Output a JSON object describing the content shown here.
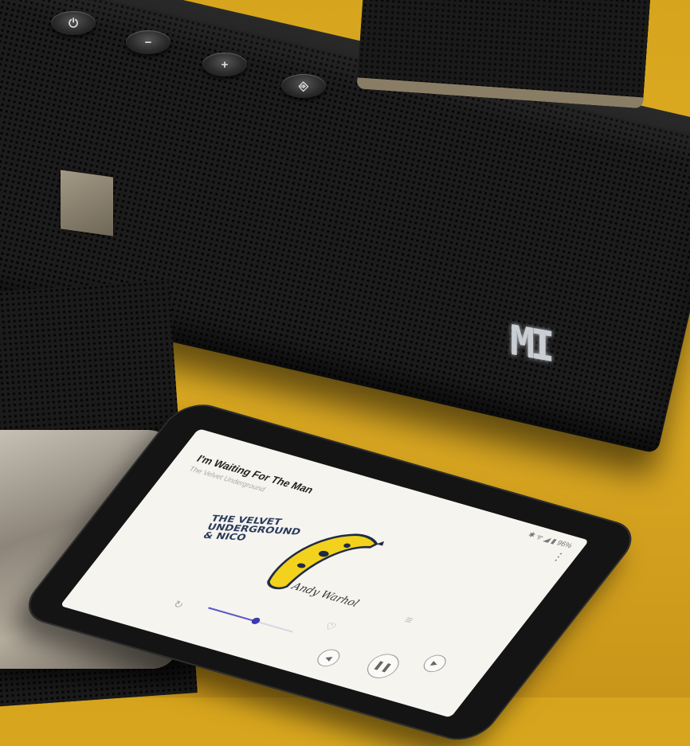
{
  "photo": {
    "background_color": "#dca923",
    "subject": ""
  },
  "soundbar": {
    "buttons": [
      {
        "icon": "power-icon",
        "glyph": "⏻"
      },
      {
        "icon": "minus-icon",
        "glyph": "−"
      },
      {
        "icon": "plus-icon",
        "glyph": "+"
      },
      {
        "icon": "input-icon",
        "glyph": "⎆"
      }
    ],
    "logo_led": "MI"
  },
  "phone": {
    "status_bar": "✱ ᯤ ◢ ▮ 96%",
    "now_playing": {
      "title": "I'm Waiting For The Man",
      "artist": "The Velvet Underground"
    },
    "album_art": {
      "band_text": "THE VELVET UNDERGROUND & NICO",
      "signature": "Andy Warhol"
    },
    "playback": {
      "progress": 0.55
    },
    "controls": {
      "prev_glyph": "◀",
      "pause_glyph": "❚❚",
      "next_glyph": "▶",
      "repeat_glyph": "↻",
      "heart_glyph": "♡",
      "list_glyph": "≡",
      "more_glyph": "⋮"
    }
  }
}
